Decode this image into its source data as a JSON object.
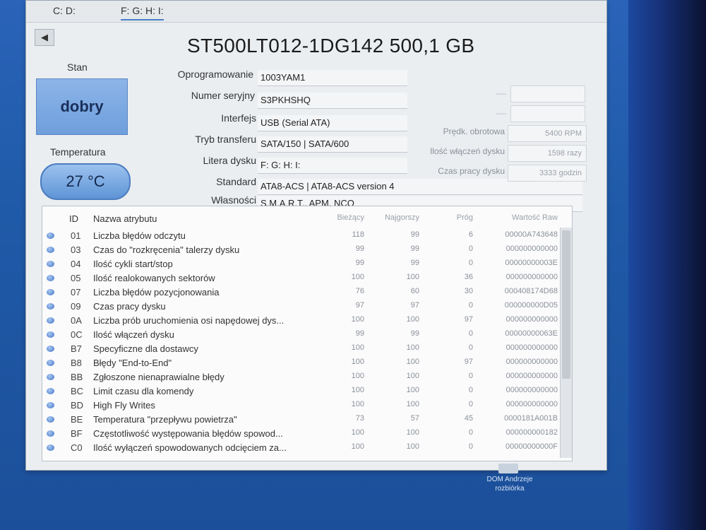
{
  "tabs": [
    "C: D:",
    "F: G: H: I:"
  ],
  "disk": {
    "title": "ST500LT012-1DG142 500,1 GB",
    "status_label": "Stan",
    "status_value": "dobry",
    "temp_label": "Temperatura",
    "temp_value": "27 °C"
  },
  "info": [
    {
      "label": "Oprogramowanie",
      "value": "1003YAM1"
    },
    {
      "label": "Numer seryjny",
      "value": "S3PKHSHQ"
    },
    {
      "label": "Interfejs",
      "value": "USB (Serial ATA)"
    },
    {
      "label": "Tryb transferu",
      "value": "SATA/150 | SATA/600"
    },
    {
      "label": "Litera dysku",
      "value": "F: G: H: I:"
    },
    {
      "label": "Standard",
      "value": "ATA8-ACS | ATA8-ACS version 4"
    },
    {
      "label": "Własności",
      "value": "S.M.A.R.T., APM, NCQ"
    }
  ],
  "right_info": [
    {
      "label": "Prędk. obrotowa",
      "value": "5400 RPM"
    },
    {
      "label": "Ilość włączeń dysku",
      "value": "1598 razy"
    },
    {
      "label": "Czas pracy dysku",
      "value": "3333 godzin"
    }
  ],
  "table": {
    "headers": {
      "id": "ID",
      "name": "Nazwa atrybutu",
      "current": "Bieżący",
      "worst": "Najgorszy",
      "threshold": "Próg",
      "raw": "Wartość Raw"
    },
    "rows": [
      {
        "id": "01",
        "name": "Liczba błędów odczytu",
        "current": "118",
        "worst": "99",
        "threshold": "6",
        "raw": "00000A743648"
      },
      {
        "id": "03",
        "name": "Czas do \"rozkręcenia\" talerzy dysku",
        "current": "99",
        "worst": "99",
        "threshold": "0",
        "raw": "000000000000"
      },
      {
        "id": "04",
        "name": "Ilość cykli start/stop",
        "current": "99",
        "worst": "99",
        "threshold": "0",
        "raw": "00000000003E"
      },
      {
        "id": "05",
        "name": "Ilość realokowanych sektorów",
        "current": "100",
        "worst": "100",
        "threshold": "36",
        "raw": "000000000000"
      },
      {
        "id": "07",
        "name": "Liczba błędów pozycjonowania",
        "current": "76",
        "worst": "60",
        "threshold": "30",
        "raw": "000408174D68"
      },
      {
        "id": "09",
        "name": "Czas pracy dysku",
        "current": "97",
        "worst": "97",
        "threshold": "0",
        "raw": "000000000D05"
      },
      {
        "id": "0A",
        "name": "Liczba prób uruchomienia osi napędowej dys...",
        "current": "100",
        "worst": "100",
        "threshold": "97",
        "raw": "000000000000"
      },
      {
        "id": "0C",
        "name": "Ilość włączeń dysku",
        "current": "99",
        "worst": "99",
        "threshold": "0",
        "raw": "00000000063E"
      },
      {
        "id": "B7",
        "name": "Specyficzne dla dostawcy",
        "current": "100",
        "worst": "100",
        "threshold": "0",
        "raw": "000000000000"
      },
      {
        "id": "B8",
        "name": "Błędy \"End-to-End\"",
        "current": "100",
        "worst": "100",
        "threshold": "97",
        "raw": "000000000000"
      },
      {
        "id": "BB",
        "name": "Zgłoszone nienaprawialne błędy",
        "current": "100",
        "worst": "100",
        "threshold": "0",
        "raw": "000000000000"
      },
      {
        "id": "BC",
        "name": "Limit czasu dla komendy",
        "current": "100",
        "worst": "100",
        "threshold": "0",
        "raw": "000000000000"
      },
      {
        "id": "BD",
        "name": "High Fly Writes",
        "current": "100",
        "worst": "100",
        "threshold": "0",
        "raw": "000000000000"
      },
      {
        "id": "BE",
        "name": "Temperatura \"przepływu powietrza\"",
        "current": "73",
        "worst": "57",
        "threshold": "45",
        "raw": "0000181A001B"
      },
      {
        "id": "BF",
        "name": "Częstotliwość występowania błędów spowod...",
        "current": "100",
        "worst": "100",
        "threshold": "0",
        "raw": "000000000182"
      },
      {
        "id": "C0",
        "name": "Ilość wyłączeń spowodowanych odcięciem za...",
        "current": "100",
        "worst": "100",
        "threshold": "0",
        "raw": "00000000000F"
      }
    ]
  },
  "desktop_icon_label": [
    "DOM Andrzeje",
    "rozbiórka"
  ]
}
